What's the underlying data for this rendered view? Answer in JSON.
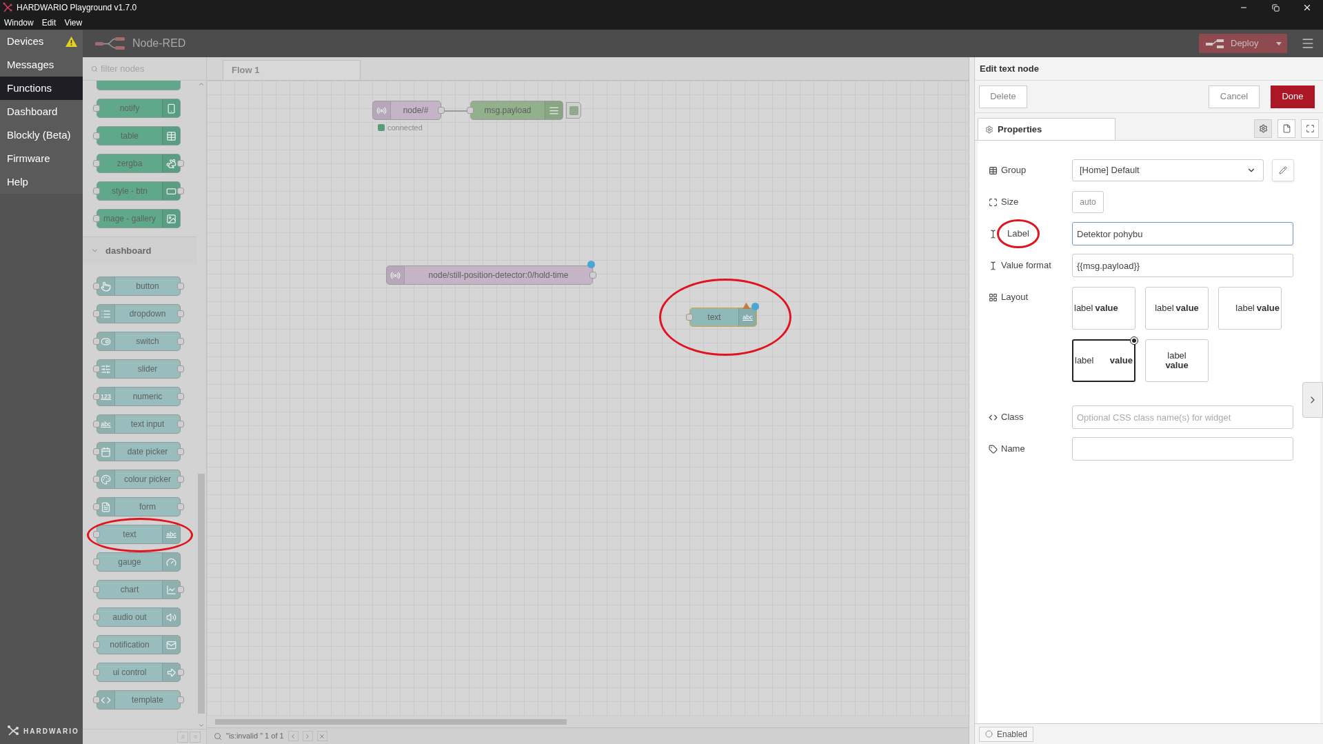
{
  "title_bar": {
    "title": "HARDWARIO Playground v1.7.0"
  },
  "menu": [
    "Window",
    "Edit",
    "View"
  ],
  "nav": {
    "items": [
      {
        "label": "Devices",
        "selected": false,
        "warning": true
      },
      {
        "label": "Messages",
        "selected": false,
        "warning": false
      },
      {
        "label": "Functions",
        "selected": true,
        "warning": false
      },
      {
        "label": "Dashboard",
        "selected": false,
        "warning": false
      },
      {
        "label": "Blockly (Beta)",
        "selected": false,
        "warning": false
      },
      {
        "label": "Firmware",
        "selected": false,
        "warning": false
      },
      {
        "label": "Help",
        "selected": false,
        "warning": false
      }
    ],
    "brand": "HARDWARIO"
  },
  "header": {
    "title": "Node-RED",
    "deploy": "Deploy"
  },
  "palette": {
    "filter_placeholder": "filter nodes",
    "sections": [
      {
        "color": "#5fa88c",
        "nodes": [
          {
            "label": "notify",
            "circled": false
          },
          {
            "label": "table",
            "circled": false
          },
          {
            "label": "zergba",
            "circled": false
          },
          {
            "label": "style - btn",
            "circled": false
          },
          {
            "label": "mage - gallery",
            "circled": false
          }
        ]
      },
      {
        "title": "dashboard",
        "expanded": true,
        "color": "#98bdbc",
        "nodes": [
          {
            "label": "button",
            "circled": false
          },
          {
            "label": "dropdown",
            "circled": false
          },
          {
            "label": "switch",
            "circled": false
          },
          {
            "label": "slider",
            "circled": false
          },
          {
            "label": "numeric",
            "icon_text": "123",
            "circled": false
          },
          {
            "label": "text input",
            "icon_text": "abc",
            "circled": false
          },
          {
            "label": "date picker",
            "circled": false
          },
          {
            "label": "colour picker",
            "circled": false
          },
          {
            "label": "form",
            "circled": false
          },
          {
            "label": "text",
            "icon_text": "abc",
            "circled": true
          },
          {
            "label": "gauge",
            "circled": false
          },
          {
            "label": "chart",
            "circled": false
          },
          {
            "label": "audio out",
            "circled": false
          },
          {
            "label": "notification",
            "circled": false
          },
          {
            "label": "ui control",
            "circled": false
          },
          {
            "label": "template",
            "circled": false
          }
        ]
      }
    ]
  },
  "workspace": {
    "tabs": [
      {
        "label": "Flow 1",
        "selected": true
      }
    ],
    "nodes": [
      {
        "label": "node/#",
        "color": "#c4b4c6",
        "status": "connected",
        "changed": false,
        "warning": false,
        "circled": false
      },
      {
        "label": "msg.payload",
        "color": "#93b08c",
        "changed": false,
        "warning": false,
        "circled": false
      },
      {
        "label": "node/still-position-detector:0/hold-time",
        "color": "#c4b4c6",
        "changed": true,
        "warning": false,
        "circled": false
      },
      {
        "label": "text",
        "color": "#8fb8b9",
        "icon_text": "abc",
        "changed": true,
        "warning": true,
        "circled": true
      }
    ],
    "search": "\"is:invalid \" 1 of 1"
  },
  "editor": {
    "title": "Edit text node",
    "delete": "Delete",
    "cancel": "Cancel",
    "done": "Done",
    "tabs": [
      {
        "label": "Properties",
        "selected": true
      }
    ],
    "rows": [
      {
        "kind": "select",
        "label": "Group",
        "value": "[Home] Default",
        "circled": false
      },
      {
        "kind": "size",
        "label": "Size",
        "value": "auto",
        "circled": false
      },
      {
        "kind": "input",
        "label": "Label",
        "value": "Detektor pohybu",
        "focused": true,
        "circled": true
      },
      {
        "kind": "input",
        "label": "Value format",
        "value": "{{msg.payload}}",
        "focused": false,
        "circled": false
      },
      {
        "kind": "layout",
        "label": "Layout",
        "circled": false,
        "options": [
          {
            "kind": "left",
            "label": "label",
            "value": "value",
            "selected": false
          },
          {
            "kind": "center",
            "label": "label",
            "value": "value",
            "selected": false
          },
          {
            "kind": "right",
            "label": "label",
            "value": "value",
            "selected": false
          },
          {
            "kind": "spread",
            "label": "label",
            "value": "value",
            "selected": true
          },
          {
            "kind": "stacked",
            "label": "label",
            "value": "value",
            "selected": false
          }
        ]
      },
      {
        "kind": "input",
        "label": "Class",
        "placeholder": "Optional CSS class name(s) for widget",
        "focused": false,
        "circled": false
      },
      {
        "kind": "input",
        "label": "Name",
        "focused": false,
        "circled": false
      }
    ],
    "enabled": {
      "label": "Enabled",
      "checked": false
    }
  }
}
